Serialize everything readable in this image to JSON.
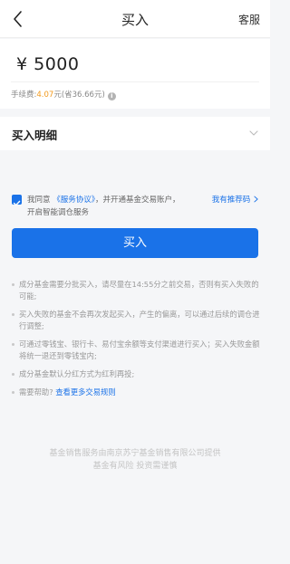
{
  "header": {
    "title": "买入",
    "right_label": "客服"
  },
  "amount": {
    "value": "¥ 5000"
  },
  "fee": {
    "prefix": "手续费:",
    "value": "4.07",
    "suffix": "元(省36.66元)"
  },
  "detail": {
    "label": "买入明细"
  },
  "consent": {
    "text_before": "我同意",
    "agreement_link": "《服务协议》",
    "text_after": "，并开通基金交易账户，",
    "line2": "开启智能调仓服务",
    "referrer_label": "我有推荐码",
    "checked": true
  },
  "buy_button": {
    "label": "买入"
  },
  "notes": [
    "成分基金需要分批买入，请尽量在14:55分之前交易，否则有买入失败的可能;",
    "买入失败的基金不会再次发起买入，产生的偏离，可以通过后续的调仓进行调整;",
    "可通过零钱宝、银行卡、易付宝余额等支付渠道进行买入；买入失败金额将统一退还到零钱宝内;",
    "成分基金默认分红方式为红利再投;"
  ],
  "help": {
    "text": "需要帮助?",
    "link": "查看更多交易规则"
  },
  "footer": {
    "line1": "基金销售服务由南京苏宁基金销售有限公司提供",
    "line2": "基金有风险 投资需谨慎"
  },
  "icons": {
    "back": "chevron-left-icon",
    "info": "info-icon",
    "expand": "chevron-down-icon",
    "checkbox": "checkbox-checked-icon",
    "referrer_arrow": "chevron-right-icon"
  },
  "colors": {
    "accent": "#1a72e8",
    "fee_highlight": "#f29a1c"
  }
}
